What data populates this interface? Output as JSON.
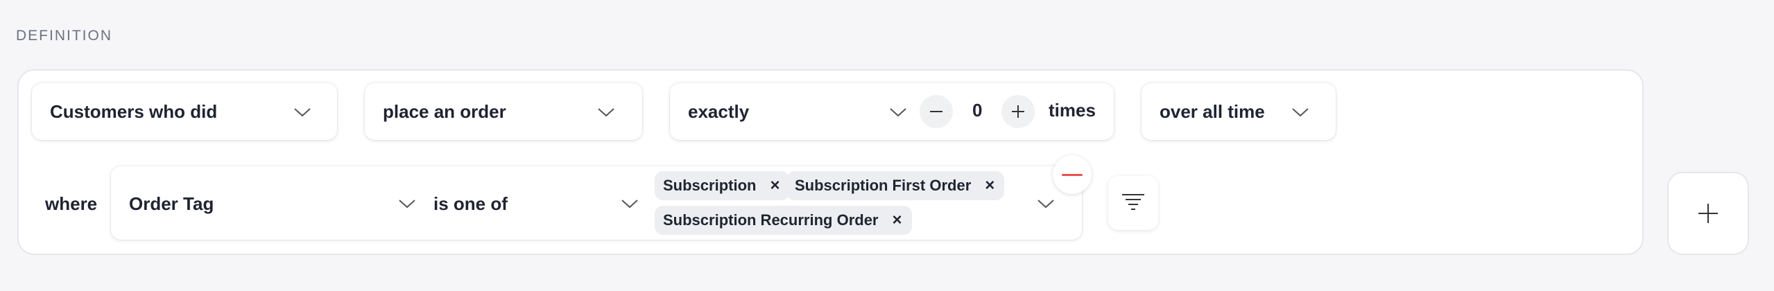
{
  "section": {
    "label": "DEFINITION"
  },
  "row1": {
    "who": {
      "value": "Customers who did"
    },
    "action": {
      "value": "place an order"
    },
    "frequency": {
      "value": "exactly",
      "count": "0",
      "suffix": "times"
    },
    "timeframe": {
      "value": "over all time"
    }
  },
  "row2": {
    "where_label": "where",
    "property": {
      "value": "Order Tag"
    },
    "operator": {
      "value": "is one of"
    },
    "tags": [
      {
        "label": "Subscription"
      },
      {
        "label": "Subscription First Order"
      },
      {
        "label": "Subscription Recurring Order"
      }
    ],
    "tag_remove_glyph": "×"
  },
  "icons": {
    "chevron": "chevron-down-icon",
    "minus": "minus-icon",
    "plus": "plus-icon",
    "remove": "remove-icon",
    "filter": "filter-icon",
    "add": "add-icon",
    "close": "close-icon"
  },
  "colors": {
    "background": "#f6f6f8",
    "card": "#ffffff",
    "text": "#1f2430",
    "muted": "#6b7280",
    "tag_bg": "#eceef1",
    "danger": "#e5534b"
  }
}
